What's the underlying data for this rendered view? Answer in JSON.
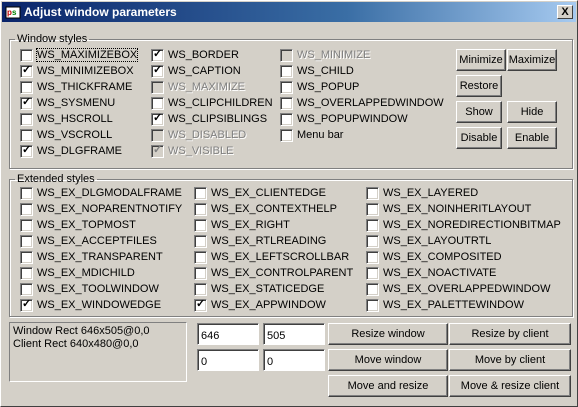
{
  "window": {
    "title": "Adjust window parameters",
    "close_glyph": "X"
  },
  "window_styles": {
    "legend": "Window styles",
    "items": [
      {
        "label": "WS_MAXIMIZEBOX",
        "checked": false,
        "disabled": false,
        "focus": true
      },
      {
        "label": "WS_MINIMIZEBOX",
        "checked": true,
        "disabled": false
      },
      {
        "label": "WS_THICKFRAME",
        "checked": false,
        "disabled": false
      },
      {
        "label": "WS_SYSMENU",
        "checked": true,
        "disabled": false
      },
      {
        "label": "WS_HSCROLL",
        "checked": false,
        "disabled": false
      },
      {
        "label": "WS_VSCROLL",
        "checked": false,
        "disabled": false
      },
      {
        "label": "WS_DLGFRAME",
        "checked": true,
        "disabled": false
      },
      {
        "label": "WS_BORDER",
        "checked": true,
        "disabled": false
      },
      {
        "label": "WS_CAPTION",
        "checked": true,
        "disabled": false
      },
      {
        "label": "WS_MAXIMIZE",
        "checked": false,
        "disabled": true
      },
      {
        "label": "WS_CLIPCHILDREN",
        "checked": false,
        "disabled": false
      },
      {
        "label": "WS_CLIPSIBLINGS",
        "checked": true,
        "disabled": false
      },
      {
        "label": "WS_DISABLED",
        "checked": false,
        "disabled": true
      },
      {
        "label": "WS_VISIBLE",
        "checked": true,
        "disabled": true
      },
      {
        "label": "WS_MINIMIZE",
        "checked": false,
        "disabled": true
      },
      {
        "label": "WS_CHILD",
        "checked": false,
        "disabled": false
      },
      {
        "label": "WS_POPUP",
        "checked": false,
        "disabled": false
      },
      {
        "label": "WS_OVERLAPPEDWINDOW",
        "checked": false,
        "disabled": false
      },
      {
        "label": "WS_POPUPWINDOW",
        "checked": false,
        "disabled": false
      },
      {
        "label": "Menu bar",
        "checked": false,
        "disabled": false
      }
    ]
  },
  "buttons": {
    "minimize": "Minimize",
    "maximize": "Maximize",
    "restore": "Restore",
    "show": "Show",
    "hide": "Hide",
    "disable": "Disable",
    "enable": "Enable",
    "resize_window": "Resize window",
    "resize_by_client": "Resize by client",
    "move_window": "Move window",
    "move_by_client": "Move by client",
    "move_and_resize": "Move and resize",
    "move_resize_client": "Move & resize client"
  },
  "extended_styles": {
    "legend": "Extended styles",
    "items": [
      {
        "label": "WS_EX_DLGMODALFRAME",
        "checked": false
      },
      {
        "label": "WS_EX_NOPARENTNOTIFY",
        "checked": false
      },
      {
        "label": "WS_EX_TOPMOST",
        "checked": false
      },
      {
        "label": "WS_EX_ACCEPTFILES",
        "checked": false
      },
      {
        "label": "WS_EX_TRANSPARENT",
        "checked": false
      },
      {
        "label": "WS_EX_MDICHILD",
        "checked": false
      },
      {
        "label": "WS_EX_TOOLWINDOW",
        "checked": false
      },
      {
        "label": "WS_EX_WINDOWEDGE",
        "checked": true
      },
      {
        "label": "WS_EX_CLIENTEDGE",
        "checked": false
      },
      {
        "label": "WS_EX_CONTEXTHELP",
        "checked": false
      },
      {
        "label": "WS_EX_RIGHT",
        "checked": false
      },
      {
        "label": "WS_EX_RTLREADING",
        "checked": false
      },
      {
        "label": "WS_EX_LEFTSCROLLBAR",
        "checked": false
      },
      {
        "label": "WS_EX_CONTROLPARENT",
        "checked": false
      },
      {
        "label": "WS_EX_STATICEDGE",
        "checked": false
      },
      {
        "label": "WS_EX_APPWINDOW",
        "checked": true
      },
      {
        "label": "WS_EX_LAYERED",
        "checked": false
      },
      {
        "label": "WS_EX_NOINHERITLAYOUT",
        "checked": false
      },
      {
        "label": "WS_EX_NOREDIRECTIONBITMAP",
        "checked": false
      },
      {
        "label": "WS_EX_LAYOUTRTL",
        "checked": false
      },
      {
        "label": "WS_EX_COMPOSITED",
        "checked": false
      },
      {
        "label": "WS_EX_NOACTIVATE",
        "checked": false
      },
      {
        "label": "WS_EX_OVERLAPPEDWINDOW",
        "checked": false
      },
      {
        "label": "WS_EX_PALETTEWINDOW",
        "checked": false
      }
    ]
  },
  "info": {
    "window_rect": "Window Rect 646x505@0,0",
    "client_rect": "Client Rect 640x480@0,0"
  },
  "fields": {
    "width": "646",
    "height": "505",
    "x": "0",
    "y": "0"
  },
  "check_glyph": "✓",
  "colors": {
    "title_start": "#0a246a",
    "title_end": "#a6caf0",
    "face": "#d4d0c8",
    "disabled_text": "#808080"
  }
}
